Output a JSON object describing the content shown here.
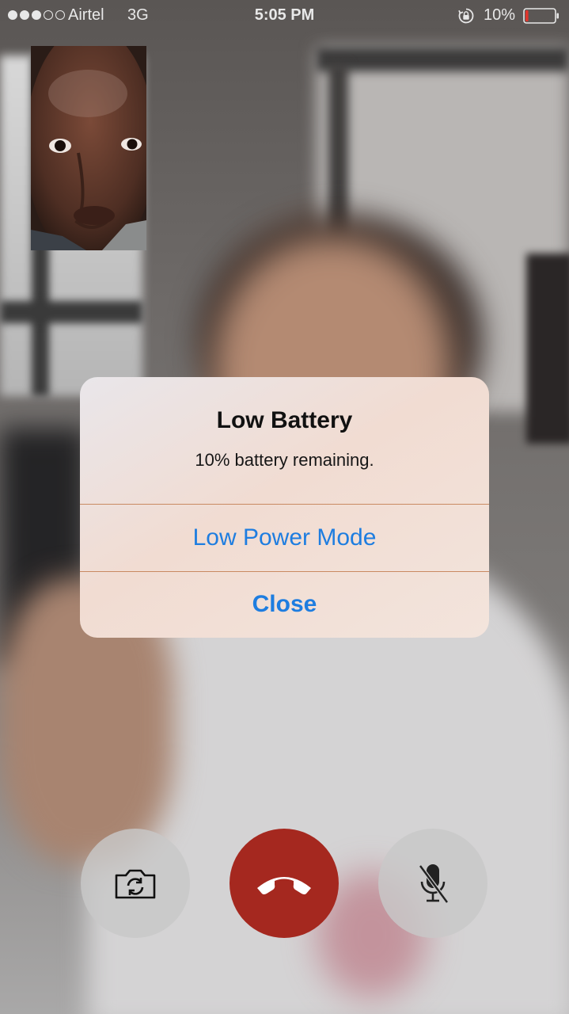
{
  "status_bar": {
    "signal_dots": [
      true,
      true,
      true,
      false,
      false
    ],
    "carrier": "Airtel",
    "network": "3G",
    "time": "5:05 PM",
    "battery_percent": "10%",
    "battery_level": 0.1,
    "battery_color": "#e0352c"
  },
  "alert": {
    "title": "Low Battery",
    "message": "10% battery remaining.",
    "buttons": [
      {
        "label": "Low Power Mode"
      },
      {
        "label": "Close"
      }
    ],
    "button_color": "#1e7de0"
  },
  "controls": {
    "flip_camera": "flip-camera-icon",
    "end_call": "end-call-icon",
    "mute": "microphone-muted-icon",
    "end_call_color": "#a5281f"
  }
}
